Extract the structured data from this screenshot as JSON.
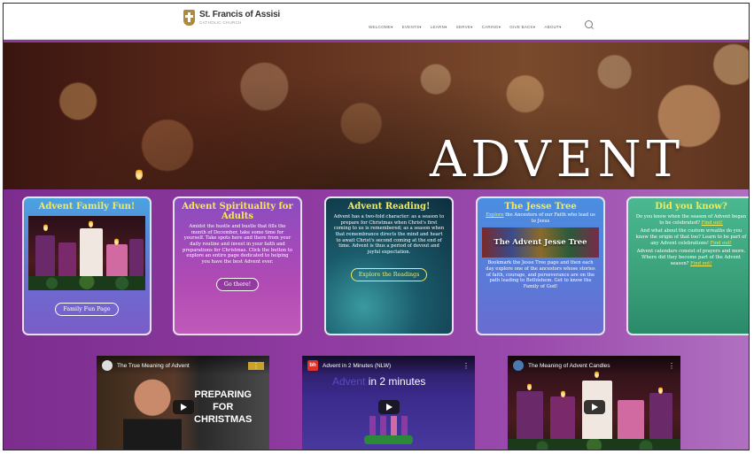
{
  "header": {
    "logo_name": "St. Francis of Assisi",
    "logo_sub": "CATHOLIC CHURCH",
    "nav": [
      "WELCOME",
      "EVENTS",
      "LEARN",
      "SERVE",
      "CARING",
      "GIVE BACK",
      "ABOUT"
    ],
    "nav_caret": "▾"
  },
  "hero": {
    "title": "ADVENT"
  },
  "cards": [
    {
      "title": "Advent Family Fun!",
      "button": "Family Fun Page"
    },
    {
      "title": "Advent Spirituality for Adults",
      "body": "Amidst the hustle and bustle that fills the month of December, take some time for yourself. Take spots here and there from your daily routine and invest in your faith and preparations for Christmas. Click the button to explore an entire page dedicated to helping you have the best Advent ever.",
      "button": "Go there!"
    },
    {
      "title": "Advent Reading!",
      "body": "Advent has a two-fold character: as a season to prepare for Christmas when Christ's first coming to us is remembered; as a season when that remembrance directs the mind and heart to await Christ's second coming at the end of time. Advent is thus a period of devout and joyful expectation.",
      "button": "Explore the Readings"
    },
    {
      "title": "The Jesse Tree",
      "link": "Explore",
      "intro": "the Ancestors of our Faith who lead us to Jesus",
      "image_label": "The Advent Jesse Tree",
      "body": "Bookmark the Jesse Tree page and then each day explore one of the ancestors whose stories of faith, courage, and perseverance are on the path leading to Bethlehem. Get to know the Family of God!"
    },
    {
      "title": "Did you know?",
      "p1": "Do you know when the season of Advent began to be celebrated?",
      "p1_link": "Find out!",
      "p2": "And what about the custom wreaths do you know the origin of that too? Learn to be part of any Advent celebrations!",
      "p2_link": "Find out!",
      "p3": "Advent calendars consist of prayers and more. Where did they become part of the Advent season?",
      "p3_link": "Find out!"
    }
  ],
  "videos": [
    {
      "title": "The True Meaning of Advent",
      "overlay": [
        "PREPARING",
        "FOR",
        "CHRISTMAS"
      ]
    },
    {
      "channel": "bh",
      "title": "Advent in 2 Minutes (NLW)",
      "overlay_a": "Advent",
      "overlay_b": "in 2 minutes"
    },
    {
      "title": "The Meaning of Advent Candles"
    }
  ],
  "menu_glyph": "⋮"
}
